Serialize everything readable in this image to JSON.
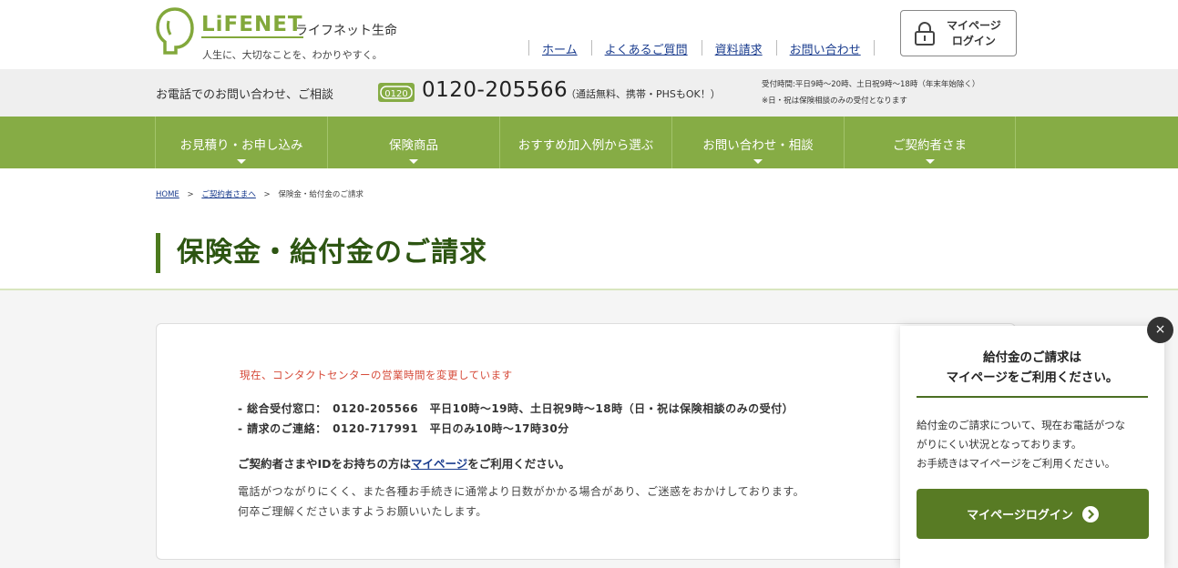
{
  "header": {
    "logo_text": "LiFENET",
    "company_name": "ライフネット生命",
    "tagline": "人生に、大切なことを、わかりやすく。",
    "nav": [
      "ホーム",
      "よくあるご質問",
      "資料請求",
      "お問い合わせ"
    ],
    "mypage_line1": "マイページ",
    "mypage_line2": "ログイン"
  },
  "phone_bar": {
    "lead": "お電話でのお問い合わせ、ご相談",
    "freedial_badge": "0120",
    "number": "0120-205566",
    "note": "（通話無料、携帯・PHSもOK！）",
    "hours_1": "受付時間:平日9時〜20時、土日祝9時〜18時（年末年始除く）",
    "hours_2": "※日・祝は保険相談のみの受付となります"
  },
  "main_nav": [
    {
      "label": "お見積り・お申し込み",
      "dropdown": true
    },
    {
      "label": "保険商品",
      "dropdown": true
    },
    {
      "label": "おすすめ加入例から選ぶ",
      "dropdown": false
    },
    {
      "label": "お問い合わせ・相談",
      "dropdown": true
    },
    {
      "label": "ご契約者さま",
      "dropdown": true
    }
  ],
  "breadcrumb": {
    "home": "HOME",
    "sep": ">",
    "parent": "ご契約者さまへ",
    "current": "保険金・給付金のご請求"
  },
  "page_title": "保険金・給付金のご請求",
  "notice": {
    "heading": "現在、コンタクトセンターの営業時間を変更しています",
    "line1": "- 総合受付窓口：　0120-205566　平日10時〜19時、土日祝9時〜18時（日・祝は保険相談のみの受付）",
    "line2": "- 請求のご連絡：　0120-717991　平日のみ10時〜17時30分",
    "mypage_prefix": "ご契約者さまやIDをお持ちの方は",
    "mypage_link": "マイページ",
    "mypage_suffix": "をご利用ください。",
    "body1": "電話がつながりにくく、また各種お手続きに通常より日数がかかる場合があり、ご迷惑をおかけしております。",
    "body2": "何卒ご理解くださいますようお願いいたします。"
  },
  "popup": {
    "title_line1": "給付金のご請求は",
    "title_line2": "マイページをご利用ください。",
    "body_line1": "給付金のご請求について、現在お電話がつな",
    "body_line2": "がりにくい状況となっております。",
    "body_line3": "お手続きはマイページをご利用ください。",
    "button_label": "マイページログイン",
    "close_glyph": "×"
  },
  "colors": {
    "brand_green": "#86ac45",
    "dark_green": "#2d5512",
    "button_green": "#587b24",
    "alert_red": "#d64b3a",
    "link_blue": "#1a3c8e"
  },
  "icons": [
    "logo-face-icon",
    "lock-icon",
    "freedial-icon",
    "chevron-down-icon",
    "arrow-right-circle-icon",
    "close-icon"
  ]
}
